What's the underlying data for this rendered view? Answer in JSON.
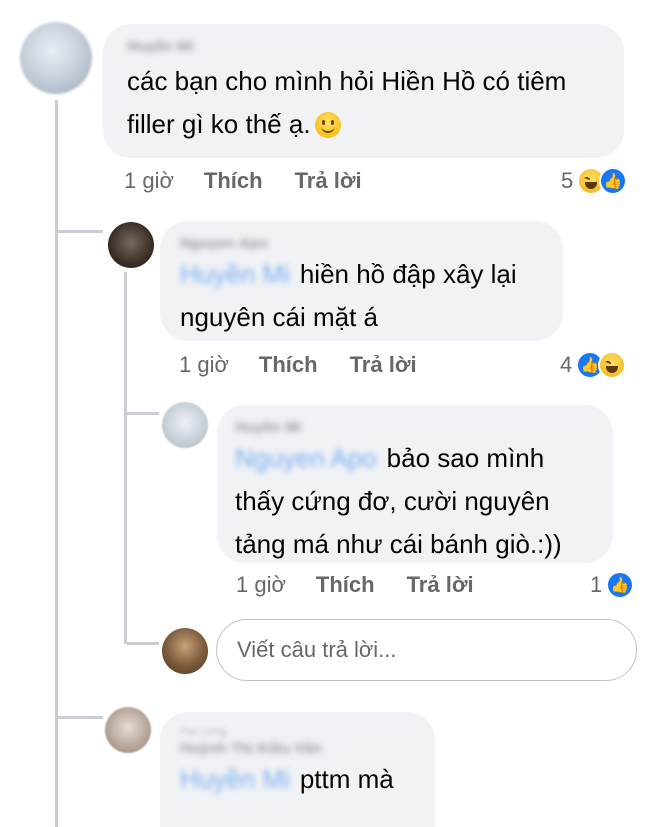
{
  "comments": [
    {
      "author": "Huyền Mi",
      "text_line1": "các bạn cho mình hỏi Hiền Hồ có tiêm",
      "text_line2": "filler gì ko thế ạ.",
      "emoji": "slightly-smiling-face-icon",
      "time": "1 giờ",
      "like_label": "Thích",
      "reply_label": "Trả lời",
      "reaction_count": "5",
      "reactions": [
        "haha-reaction-icon",
        "like-reaction-icon"
      ]
    },
    {
      "author": "Nguyen Apo",
      "mention": "Huyền Mi",
      "text_line1": "hiền hồ đập xây lại",
      "text_line2": "nguyên cái mặt á",
      "time": "1 giờ",
      "like_label": "Thích",
      "reply_label": "Trả lời",
      "reaction_count": "4",
      "reactions": [
        "like-reaction-icon",
        "haha-reaction-icon"
      ]
    },
    {
      "author": "Huyền Mi",
      "mention": "Nguyen Apo",
      "text_line1": "bảo sao mình",
      "text_line2": "thấy cứng đơ, cười nguyên",
      "text_line3": "tảng má như cái bánh giò.:))",
      "time": "1 giờ",
      "like_label": "Thích",
      "reply_label": "Trả lời",
      "reaction_count": "1",
      "reactions": [
        "like-reaction-icon"
      ]
    },
    {
      "sub_label": "Fan cứng",
      "author": "Huỳnh Thị Kiều Vân",
      "mention": "Huyền Mi",
      "text": "pttm mà"
    }
  ],
  "reply_box": {
    "placeholder": "Viết câu trả lời..."
  },
  "colors": {
    "bubble": "#f0f2f5",
    "action_text": "#65676b",
    "like_blue": "#1877f2",
    "thread_line": "#c9ccd1"
  }
}
